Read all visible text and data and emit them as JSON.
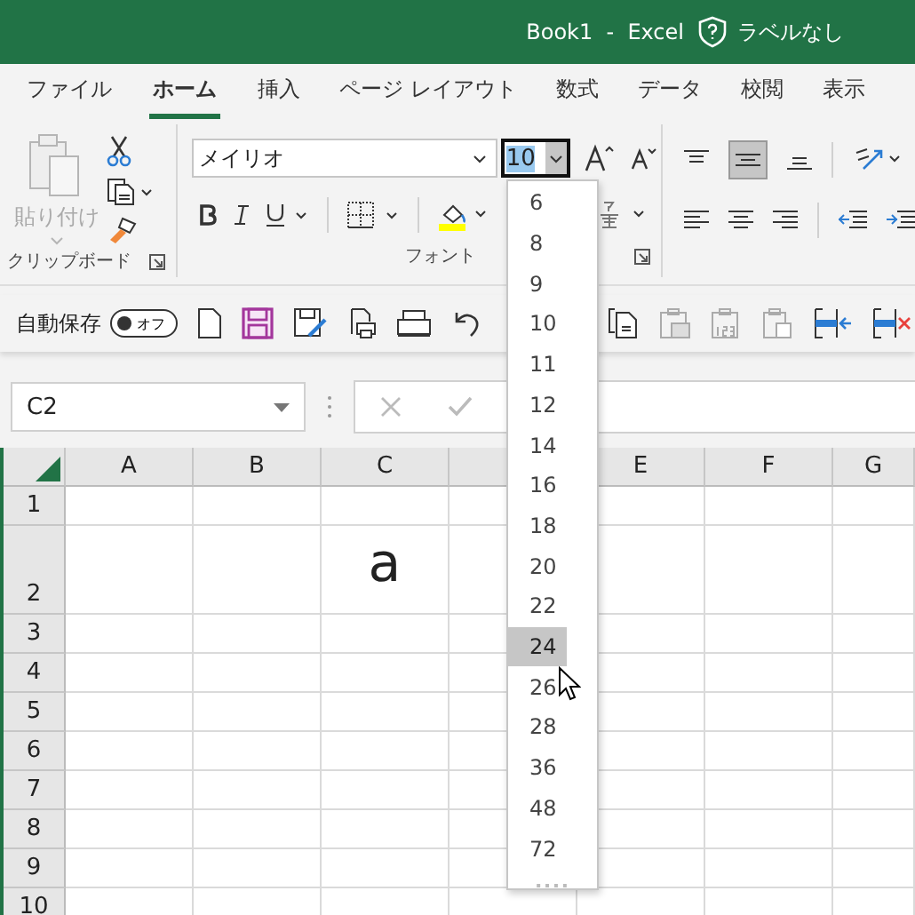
{
  "window": {
    "title": "Book1  -  Excel",
    "sensitivity_label": "ラベルなし"
  },
  "tabs": [
    {
      "label": "ファイル",
      "selected": false
    },
    {
      "label": "ホーム",
      "selected": true
    },
    {
      "label": "挿入",
      "selected": false
    },
    {
      "label": "ページ レイアウト",
      "selected": false
    },
    {
      "label": "数式",
      "selected": false
    },
    {
      "label": "データ",
      "selected": false
    },
    {
      "label": "校閲",
      "selected": false
    },
    {
      "label": "表示",
      "selected": false
    }
  ],
  "ribbon": {
    "clipboard": {
      "paste_label": "貼り付け",
      "paste_disabled": true,
      "group_label": "クリップボード"
    },
    "font": {
      "font_name": "メイリオ",
      "font_size": "10",
      "group_label": "フォント"
    }
  },
  "quick_access": {
    "autosave_label": "自動保存",
    "autosave_state": "オフ",
    "autosave_on": false
  },
  "name_box": {
    "value": "C2"
  },
  "size_dropdown": {
    "items": [
      {
        "label": "6",
        "selected": false
      },
      {
        "label": "8",
        "selected": false
      },
      {
        "label": "9",
        "selected": false
      },
      {
        "label": "10",
        "selected": false
      },
      {
        "label": "11",
        "selected": false
      },
      {
        "label": "12",
        "selected": false
      },
      {
        "label": "14",
        "selected": false
      },
      {
        "label": "16",
        "selected": false
      },
      {
        "label": "18",
        "selected": false
      },
      {
        "label": "20",
        "selected": false
      },
      {
        "label": "22",
        "selected": false
      },
      {
        "label": "24",
        "selected": true
      },
      {
        "label": "26",
        "selected": false
      },
      {
        "label": "28",
        "selected": false
      },
      {
        "label": "36",
        "selected": false
      },
      {
        "label": "48",
        "selected": false
      },
      {
        "label": "72",
        "selected": false
      }
    ]
  },
  "sheet": {
    "columns": [
      {
        "label": "A"
      },
      {
        "label": "B"
      },
      {
        "label": "C"
      },
      {},
      {
        "label": "E"
      },
      {
        "label": "F"
      },
      {
        "label": "G"
      }
    ],
    "rows": [
      {
        "header": "1",
        "cells": []
      },
      {
        "header": "2",
        "cells": [
          {},
          {},
          {
            "value": "a"
          }
        ]
      },
      {
        "header": "3",
        "cells": []
      },
      {
        "header": "4",
        "cells": []
      },
      {
        "header": "5",
        "cells": []
      },
      {
        "header": "6",
        "cells": []
      },
      {
        "header": "7",
        "cells": []
      },
      {
        "header": "8",
        "cells": []
      },
      {
        "header": "9",
        "cells": []
      },
      {
        "header": "10",
        "cells": []
      }
    ]
  }
}
